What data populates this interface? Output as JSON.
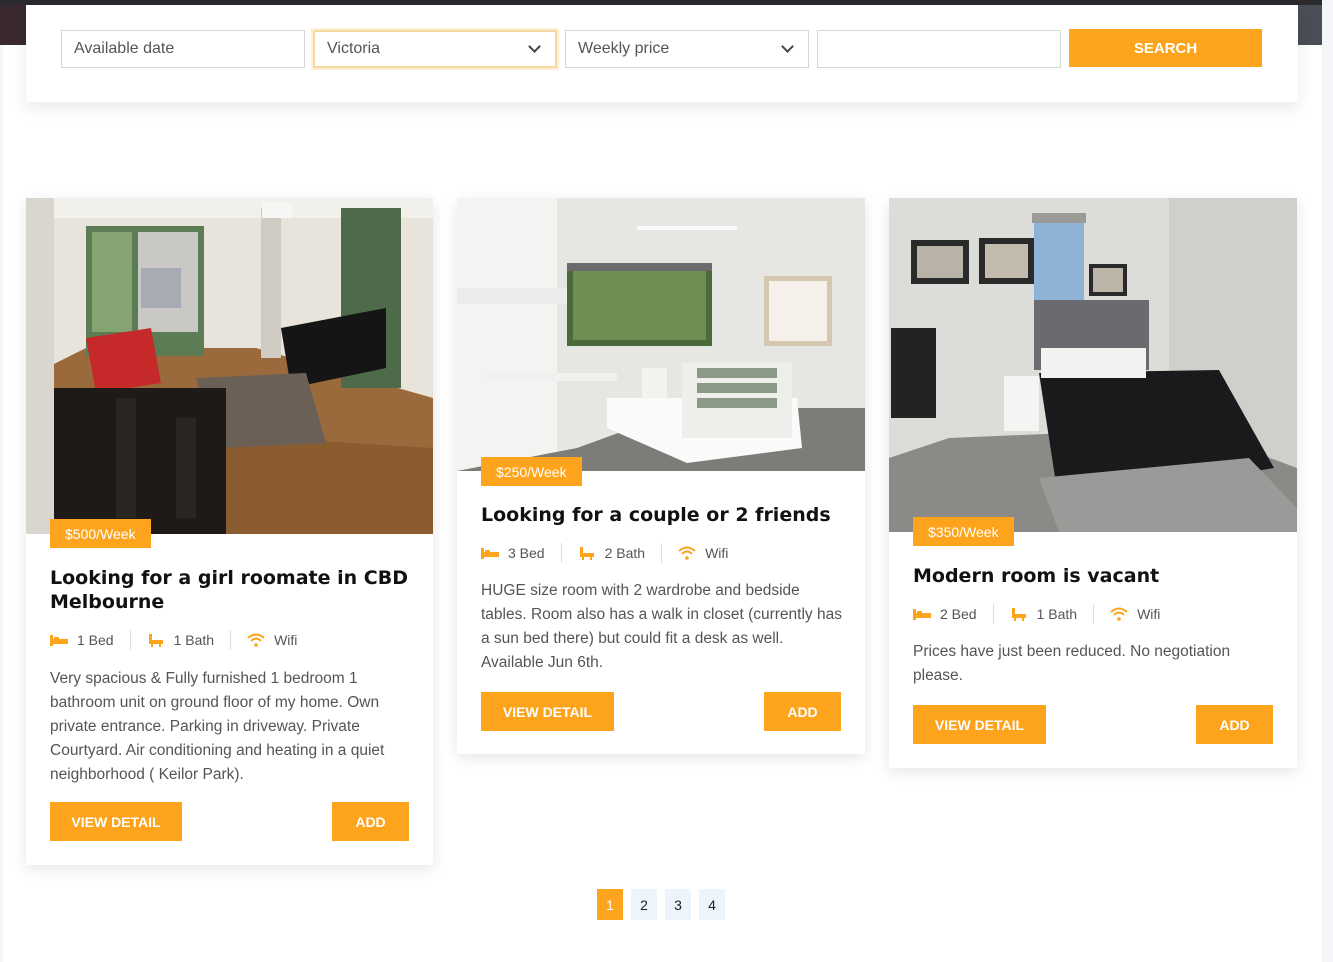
{
  "search": {
    "date_placeholder": "Available date",
    "location_value": "Victoria",
    "price_placeholder": "Weekly price",
    "keyword_value": "",
    "button_label": "SEARCH"
  },
  "listings": [
    {
      "price": "$500/Week",
      "title": "Looking for a girl roomate in CBD Melbourne",
      "bed": "1 Bed",
      "bath": "1 Bath",
      "wifi": "Wifi",
      "description": "Very spacious & Fully furnished 1 bedroom 1 bathroom unit on ground floor of my home. Own private entrance. Parking in driveway. Private Courtyard. Air conditioning and heating in a quiet neighborhood ( Keilor Park).",
      "view_label": "VIEW DETAIL",
      "add_label": "ADD"
    },
    {
      "price": "$250/Week",
      "title": "Looking for a couple or 2 friends",
      "bed": "3 Bed",
      "bath": "2 Bath",
      "wifi": "Wifi",
      "description": "HUGE size room with 2 wardrobe and bedside tables. Room also has a walk in closet (currently has a sun bed there) but could fit a desk as well. Available Jun 6th.",
      "view_label": "VIEW DETAIL",
      "add_label": "ADD"
    },
    {
      "price": "$350/Week",
      "title": "Modern room is vacant",
      "bed": "2 Bed",
      "bath": "1 Bath",
      "wifi": "Wifi",
      "description": "Prices have just been reduced. No negotiation please.",
      "view_label": "VIEW DETAIL",
      "add_label": "ADD"
    }
  ],
  "pagination": {
    "pages": [
      "1",
      "2",
      "3",
      "4"
    ],
    "current": "1"
  },
  "colors": {
    "accent": "#fda41c",
    "title": "#111111",
    "text": "#555555"
  },
  "icons": [
    "chevron-down-icon",
    "bed-icon",
    "bath-icon",
    "wifi-icon"
  ]
}
